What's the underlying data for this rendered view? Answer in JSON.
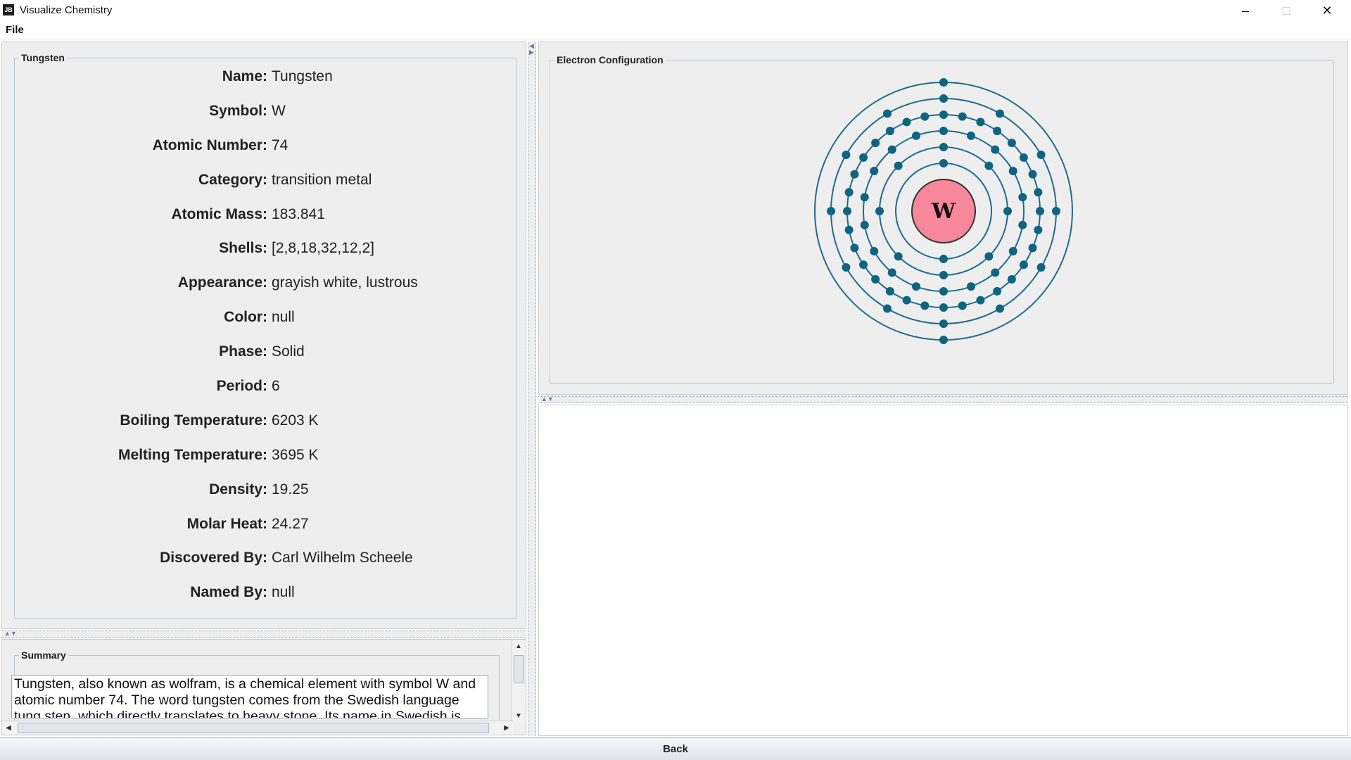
{
  "window": {
    "title": "Visualize Chemistry",
    "app_icon_text": "JB",
    "minimize": "–",
    "maximize": "□",
    "close": "✕"
  },
  "menu": {
    "file": "File"
  },
  "details": {
    "group_title": "Tungsten",
    "rows": [
      {
        "label": "Name:",
        "value": "Tungsten"
      },
      {
        "label": "Symbol:",
        "value": "W"
      },
      {
        "label": "Atomic Number:",
        "value": "74"
      },
      {
        "label": "Category:",
        "value": "transition metal"
      },
      {
        "label": "Atomic Mass:",
        "value": "183.841"
      },
      {
        "label": "Shells:",
        "value": "[2,8,18,32,12,2]"
      },
      {
        "label": "Appearance:",
        "value": "grayish white, lustrous"
      },
      {
        "label": "Color:",
        "value": "null"
      },
      {
        "label": "Phase:",
        "value": "Solid"
      },
      {
        "label": "Period:",
        "value": "6"
      },
      {
        "label": "Boiling Temperature:",
        "value": "6203 K"
      },
      {
        "label": "Melting Temperature:",
        "value": "3695 K"
      },
      {
        "label": "Density:",
        "value": "19.25"
      },
      {
        "label": "Molar Heat:",
        "value": "24.27"
      },
      {
        "label": "Discovered By:",
        "value": "Carl Wilhelm Scheele"
      },
      {
        "label": "Named By:",
        "value": "null"
      }
    ]
  },
  "summary": {
    "group_title": "Summary",
    "text": "Tungsten, also known as wolfram, is a chemical element with symbol W and atomic number 74. The word tungsten comes from the Swedish language tung sten, which directly translates to heavy stone. Its name in Swedish is"
  },
  "electron_config": {
    "group_title": "Electron Configuration",
    "nucleus_symbol": "W",
    "shells": [
      2,
      8,
      18,
      32,
      12,
      2
    ],
    "colors": {
      "nucleus_fill": "#f7879a",
      "nucleus_stroke": "#333333",
      "orbit": "#1f6d8c",
      "electron": "#0f6482"
    }
  },
  "footer": {
    "back_label": "Back"
  }
}
